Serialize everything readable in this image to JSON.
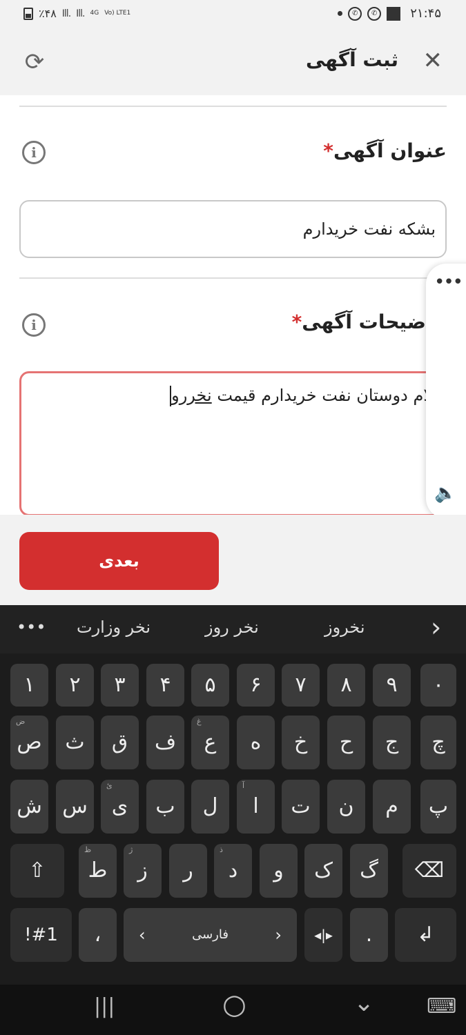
{
  "status_bar": {
    "battery": "٪۴۸",
    "signal_1": "Ill.",
    "signal_2": "Ill.",
    "network_top": "4G",
    "network_bottom": "Vo) LTE1",
    "time": "۲۱:۴۵"
  },
  "header": {
    "title": "ثبت آگهی",
    "close_icon": "close-icon",
    "refresh_icon": "refresh-icon"
  },
  "form": {
    "title_label": "عنوان آگهی",
    "required_mark": "*",
    "title_value": "بشکه نفت خریدارم",
    "desc_label": "ضیحات آگهی",
    "desc_value": "لام دوستان نفت خریدارم قیمت",
    "desc_underlined": "نخررو"
  },
  "side_panel": {
    "more_label": "•••",
    "volume_icon": "volume-icon"
  },
  "actions": {
    "next_label": "بعدی"
  },
  "keyboard": {
    "suggestions": [
      "نخروز",
      "نخر روز",
      "نخر وزارت"
    ],
    "more_label": "•••",
    "expand_label": "›",
    "number_row": [
      "۰",
      "۹",
      "۸",
      "۷",
      "۶",
      "۵",
      "۴",
      "۳",
      "۲",
      "۱"
    ],
    "row2": [
      {
        "key": "چ",
        "hint": ""
      },
      {
        "key": "ج",
        "hint": ""
      },
      {
        "key": "ح",
        "hint": ""
      },
      {
        "key": "خ",
        "hint": ""
      },
      {
        "key": "ه",
        "hint": ""
      },
      {
        "key": "ع",
        "hint": "غ"
      },
      {
        "key": "ف",
        "hint": ""
      },
      {
        "key": "ق",
        "hint": ""
      },
      {
        "key": "ث",
        "hint": ""
      },
      {
        "key": "ص",
        "hint": "ض"
      }
    ],
    "row3": [
      {
        "key": "پ",
        "hint": ""
      },
      {
        "key": "م",
        "hint": ""
      },
      {
        "key": "ن",
        "hint": ""
      },
      {
        "key": "ت",
        "hint": ""
      },
      {
        "key": "ا",
        "hint": "آ"
      },
      {
        "key": "ل",
        "hint": ""
      },
      {
        "key": "ب",
        "hint": ""
      },
      {
        "key": "ی",
        "hint": "ئ"
      },
      {
        "key": "س",
        "hint": ""
      },
      {
        "key": "ش",
        "hint": ""
      }
    ],
    "row4": [
      {
        "key": "گ",
        "hint": ""
      },
      {
        "key": "ک",
        "hint": ""
      },
      {
        "key": "و",
        "hint": ""
      },
      {
        "key": "د",
        "hint": "ذ"
      },
      {
        "key": "ر",
        "hint": ""
      },
      {
        "key": "ز",
        "hint": "ژ"
      },
      {
        "key": "ط",
        "hint": "ظ"
      }
    ],
    "shift_label": "⇧",
    "backspace_label": "⌫",
    "symbols_label": "!#1",
    "comma_label": "،",
    "space_label": "فارسی",
    "space_left": "‹",
    "space_right": "›",
    "cursor_label": "◂|▸",
    "period_label": ".",
    "enter_label": "↲"
  },
  "nav_bar": {
    "recents": "|||",
    "home": "○",
    "back": "⌄",
    "keyboard": "⌨"
  }
}
